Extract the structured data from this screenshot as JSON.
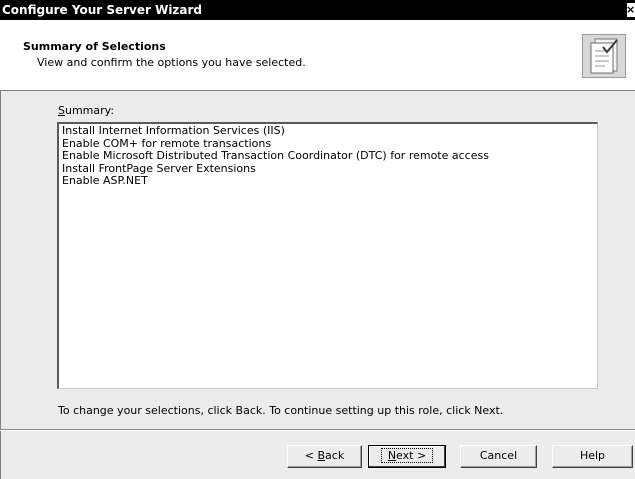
{
  "window": {
    "title": "Configure Your Server Wizard",
    "close_glyph": "×"
  },
  "header": {
    "title": "Summary of Selections",
    "subtitle": "View and confirm the options you have selected.",
    "icon": "server-checklist-icon"
  },
  "summary": {
    "label_mnemonic": "S",
    "label_rest": "ummary:",
    "items": [
      "Install Internet Information Services (IIS)",
      "Enable COM+ for remote transactions",
      "Enable Microsoft Distributed Transaction Coordinator (DTC) for remote access",
      "Install FrontPage Server Extensions",
      "Enable ASP.NET"
    ]
  },
  "hint": "To change your selections, click Back. To continue setting up this role, click Next.",
  "buttons": {
    "back_prefix": "< ",
    "back_mnemonic": "B",
    "back_rest": "ack",
    "next_mnemonic": "N",
    "next_rest": "ext >",
    "cancel": "Cancel",
    "help": "Help"
  }
}
